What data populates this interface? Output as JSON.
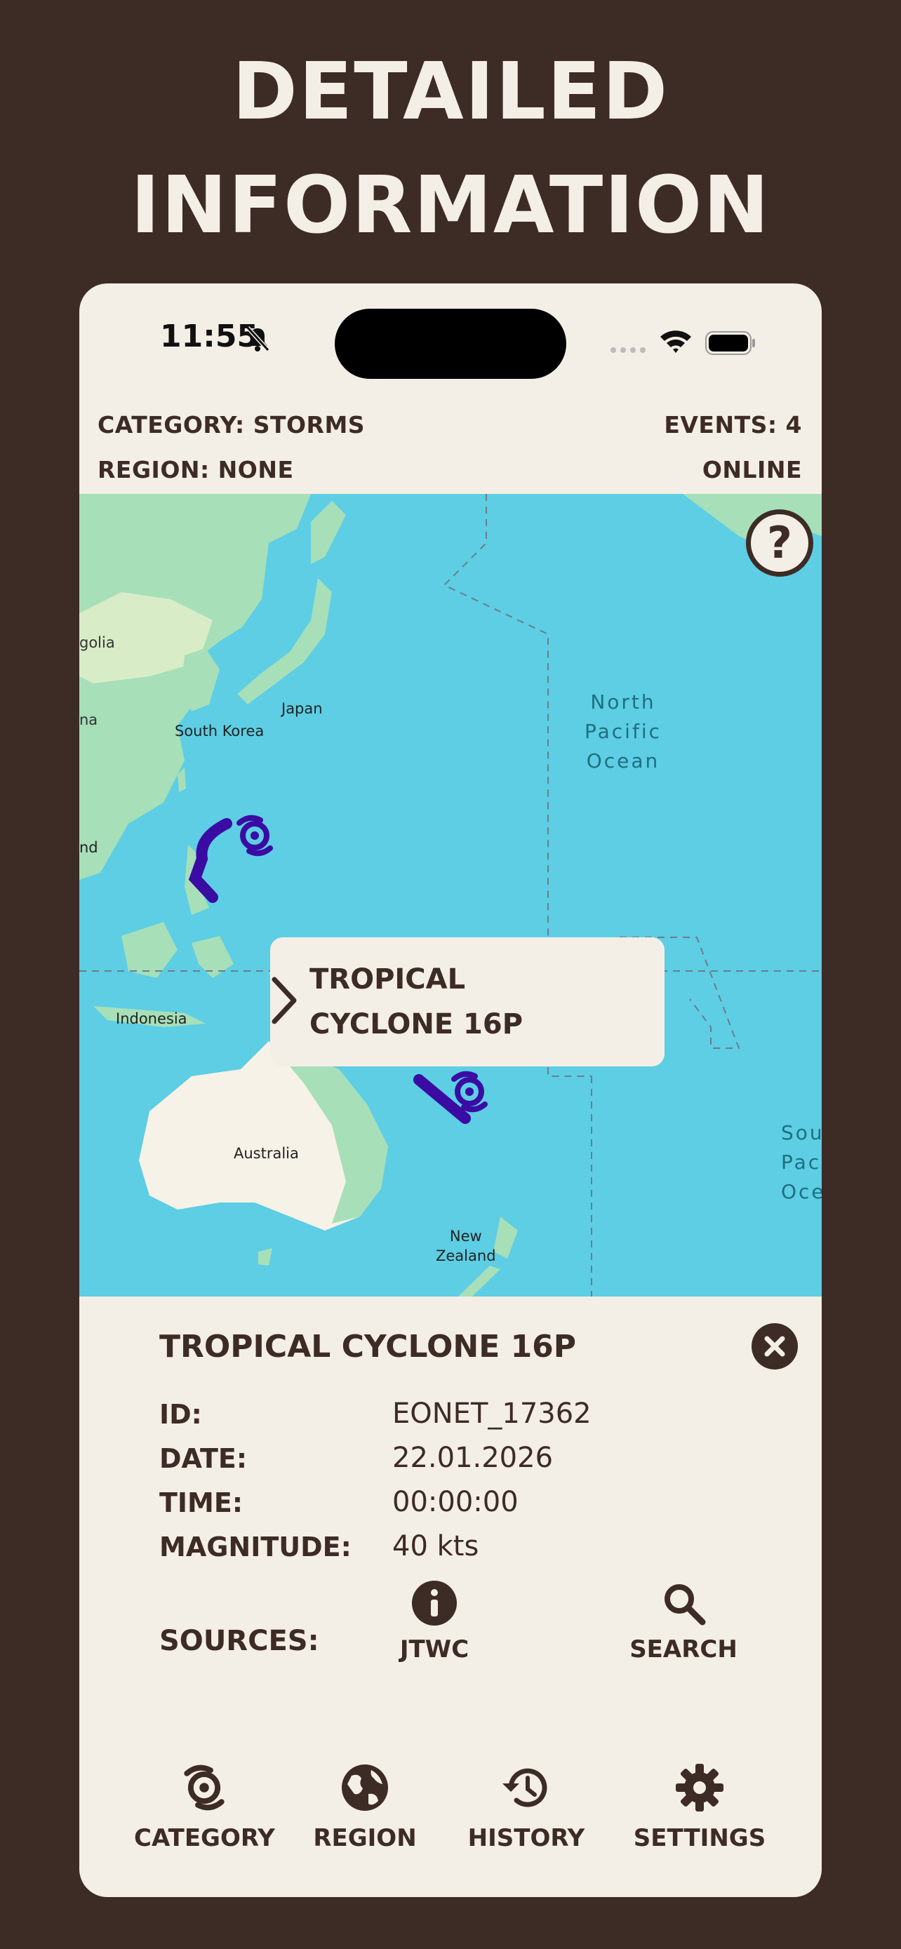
{
  "promo": {
    "line1": "DETAILED",
    "line2": "INFORMATION"
  },
  "status_bar": {
    "time": "11:55"
  },
  "header": {
    "category": "CATEGORY: STORMS",
    "events": "EVENTS: 4",
    "region": "REGION: NONE",
    "connection": "ONLINE"
  },
  "map": {
    "help_label": "?",
    "labels": {
      "mongolia": "golia",
      "china": "na",
      "thailand": "nd",
      "south_korea": "South Korea",
      "japan": "Japan",
      "indonesia": "Indonesia",
      "australia": "Australia",
      "new_zealand_1": "New",
      "new_zealand_2": "Zealand",
      "npo_1": "North",
      "npo_2": "Pacific",
      "npo_3": "Ocean",
      "spo_1": "Sou",
      "spo_2": "Paci",
      "spo_3": "Oce"
    },
    "callout": {
      "line1": "TROPICAL",
      "line2": "CYCLONE 16P"
    },
    "storm_color": "#3a0ca3"
  },
  "detail": {
    "title": "TROPICAL CYCLONE 16P",
    "rows": [
      {
        "label": "ID:",
        "value": "EONET_17362"
      },
      {
        "label": "DATE:",
        "value": "22.01.2026"
      },
      {
        "label": "TIME:",
        "value": "00:00:00"
      },
      {
        "label": "MAGNITUDE:",
        "value": "40 kts"
      }
    ],
    "sources_label": "SOURCES:",
    "sources": [
      {
        "label": "JTWC",
        "icon": "info-icon"
      },
      {
        "label": "SEARCH",
        "icon": "search-icon"
      }
    ]
  },
  "tabs": [
    {
      "label": "CATEGORY",
      "icon": "cyclone-icon"
    },
    {
      "label": "REGION",
      "icon": "globe-icon"
    },
    {
      "label": "HISTORY",
      "icon": "history-icon"
    },
    {
      "label": "SETTINGS",
      "icon": "gear-icon"
    }
  ],
  "colors": {
    "background": "#3d2b25",
    "panel": "#f4efe6",
    "ocean": "#5dcee4",
    "land": "#a7dfb9",
    "text": "#3d2b25"
  }
}
